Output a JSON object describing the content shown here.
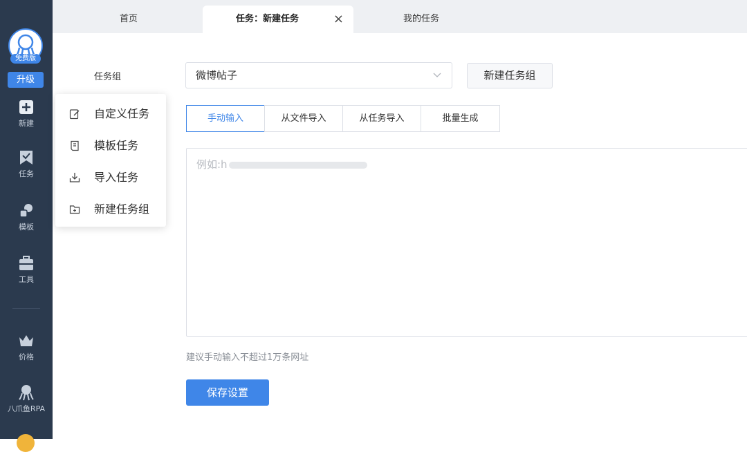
{
  "sidebar": {
    "free_badge": "免费版",
    "upgrade_label": "升级",
    "items": [
      {
        "label": "新建",
        "icon": "plus-icon"
      },
      {
        "label": "任务",
        "icon": "task-icon"
      },
      {
        "label": "模板",
        "icon": "template-icon"
      },
      {
        "label": "工具",
        "icon": "toolbox-icon"
      },
      {
        "label": "价格",
        "icon": "crown-icon"
      },
      {
        "label": "八爪鱼RPA",
        "icon": "octopus-icon"
      }
    ]
  },
  "tabs": [
    {
      "label": "首页"
    },
    {
      "label": "任务：新建任务",
      "active": true,
      "close": "×"
    },
    {
      "label": "我的任务"
    }
  ],
  "form": {
    "group_label": "任务组",
    "group_value": "微博帖子",
    "new_group_button": "新建任务组",
    "segments": [
      "手动输入",
      "从文件导入",
      "从任务导入",
      "批量生成"
    ],
    "active_segment": 0,
    "textarea_placeholder": "例如:h",
    "hint": "建议手动输入不超过1万条网址",
    "save_button": "保存设置"
  },
  "menu": {
    "items": [
      {
        "label": "自定义任务",
        "icon": "edit-icon"
      },
      {
        "label": "模板任务",
        "icon": "document-icon"
      },
      {
        "label": "导入任务",
        "icon": "import-icon"
      },
      {
        "label": "新建任务组",
        "icon": "folder-add-icon"
      }
    ]
  },
  "colors": {
    "sidebar_bg": "#2b3a4e",
    "accent": "#3f86e8"
  }
}
